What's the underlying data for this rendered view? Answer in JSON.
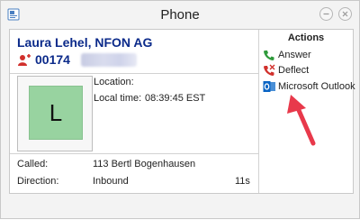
{
  "window": {
    "title": "Phone"
  },
  "caller": {
    "name": "Laura Lehel, NFON AG",
    "number": "00174",
    "avatar_initial": "L"
  },
  "info": {
    "location_label": "Location:",
    "local_time_label": "Local time:",
    "local_time_value": "08:39:45 EST"
  },
  "call": {
    "called_label": "Called:",
    "called_value": "113  Bertl Bogenhausen",
    "direction_label": "Direction:",
    "direction_value": "Inbound",
    "duration": "11s"
  },
  "actions": {
    "header": "Actions",
    "items": [
      {
        "label": "Answer",
        "icon": "phone-answer-icon"
      },
      {
        "label": "Deflect",
        "icon": "phone-deflect-icon"
      },
      {
        "label": "Microsoft Outlook",
        "icon": "outlook-icon"
      }
    ]
  },
  "colors": {
    "name_blue": "#0b2a8a",
    "avatar_green": "#98d3a0",
    "arrow_red": "#e8394b"
  }
}
